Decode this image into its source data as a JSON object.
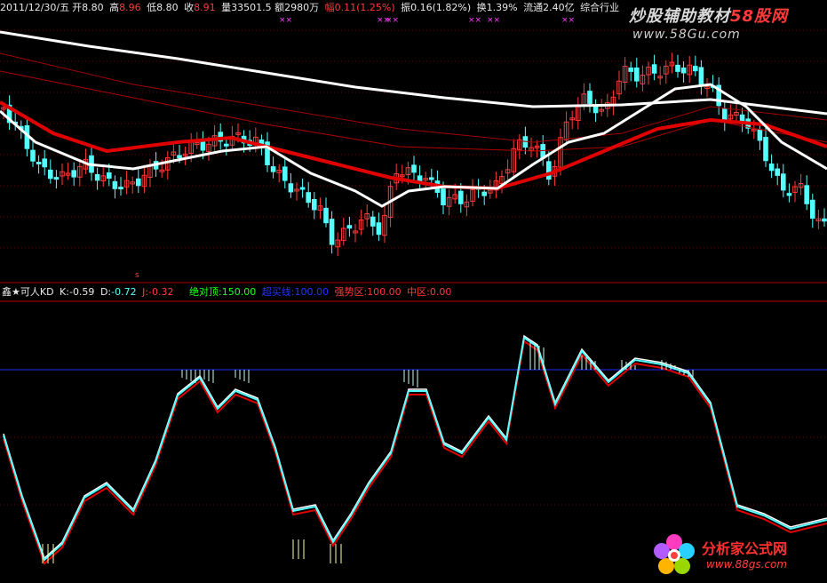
{
  "header": {
    "date": "2011/12/30/五",
    "open_label": "开",
    "open": "8.80",
    "high_label": "高",
    "high": "8.96",
    "low_label": "低",
    "low": "8.80",
    "close_label": "收",
    "close": "8.91",
    "volume_label": "量",
    "volume": "33501.5",
    "amount_label": "额",
    "amount": "2980万",
    "change_label": "幅",
    "change": "0.11(1.25%)",
    "amplitude_label": "振",
    "amplitude": "0.16(1.82%)",
    "turnover_label": "换",
    "turnover": "1.39%",
    "float_label": "流通",
    "float": "2.40亿",
    "industry": "综合行业"
  },
  "kd_indicator": {
    "name": "鑫★可人KD",
    "k_label": "K:",
    "k": "-0.59",
    "d_label": "D:",
    "d": "-0.72",
    "j_label": "J:",
    "j": "-0.32",
    "top_label": "绝对顶:",
    "top": "150.00",
    "ceiling_label": "超买线:",
    "ceiling": "100.00",
    "strong_label": "强势区:",
    "strong": "100.00",
    "mid_label": "中区:",
    "mid": "0.00"
  },
  "markers": {
    "cross": "××",
    "s": "s"
  },
  "watermarks": {
    "site1_prefix": "炒股辅助教材",
    "site1_suffix": "58股网",
    "site1_url": "www.58Gu.com",
    "site2_name": "分析家公式网",
    "site2_url": "www.88gs.com"
  },
  "colors": {
    "up": "#ff3a3a",
    "down": "#54ffff",
    "ma_white": "#ffffff",
    "ma_red": "#e00000",
    "k_line": "#5ff",
    "d_line": "#ffffff",
    "j_line": "#e00000",
    "blue_level": "#1a2aff"
  }
}
